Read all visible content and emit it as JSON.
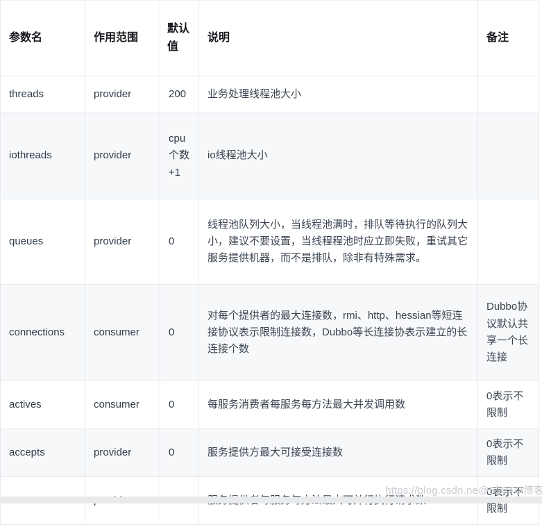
{
  "table": {
    "headers": {
      "name": "参数名",
      "scope": "作用范围",
      "default": "默认值",
      "description": "说明",
      "remark": "备注"
    },
    "rows": [
      {
        "name": "threads",
        "scope": "provider",
        "default": "200",
        "description": "业务处理线程池大小",
        "remark": ""
      },
      {
        "name": "iothreads",
        "scope": "provider",
        "default": "cpu 个数 +1",
        "description": "io线程池大小",
        "remark": ""
      },
      {
        "name": "queues",
        "scope": "provider",
        "default": "0",
        "description": "线程池队列大小，当线程池满时，排队等待执行的队列大小，建议不要设置，当线程程池时应立即失败，重试其它服务提供机器，而不是排队，除非有特殊需求。",
        "remark": ""
      },
      {
        "name": "connections",
        "scope": "consumer",
        "default": "0",
        "description": "对每个提供者的最大连接数，rmi、http、hessian等短连接协议表示限制连接数，Dubbo等长连接协表示建立的长连接个数",
        "remark": "Dubbo协议默认共享一个长连接"
      },
      {
        "name": "actives",
        "scope": "consumer",
        "default": "0",
        "description": "每服务消费者每服务每方法最大并发调用数",
        "remark": "0表示不限制"
      },
      {
        "name": "accepts",
        "scope": "provider",
        "default": "0",
        "description": "服务提供方最大可接受连接数",
        "remark": "0表示不限制"
      },
      {
        "name": "executes",
        "scope": "provider",
        "default": "0",
        "description": "服务提供者每服务每方法最大可并行执行请求数",
        "remark": "0表示不限制"
      }
    ]
  },
  "watermark": {
    "text": "https://blog.csdn.ne@51CTO博客"
  },
  "colors": {
    "header_text": "#16181c",
    "body_text": "#2f3b49",
    "border": "#e6e9ee",
    "stripe": "#f6f8fa",
    "watermark": "#c9ccd1"
  }
}
